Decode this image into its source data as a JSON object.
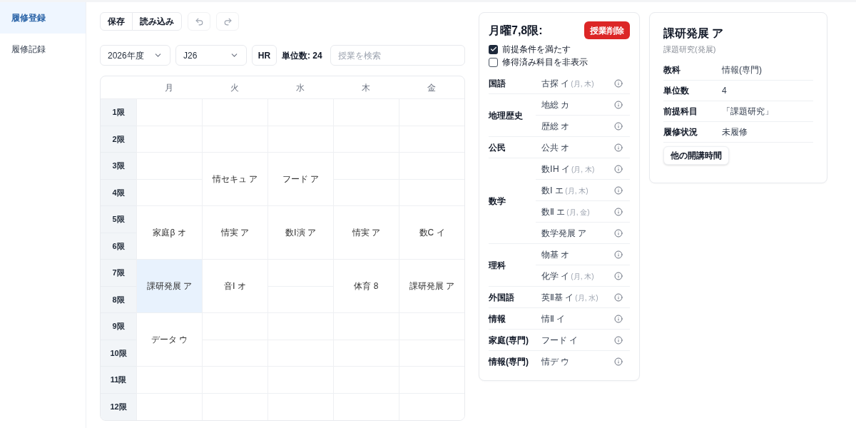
{
  "sidebar": {
    "items": [
      {
        "label": "履修登録",
        "selected": true
      },
      {
        "label": "履修記録",
        "selected": false
      }
    ]
  },
  "toolbar": {
    "file_buttons": [
      "保存",
      "読み込み"
    ]
  },
  "filters": {
    "year": "2026年度",
    "class": "J26",
    "hr_button": "HR",
    "credits": "単位数: 24",
    "search": {
      "placeholder": "授業を検索"
    }
  },
  "timetable": {
    "periods": [
      "1限",
      "2限",
      "3限",
      "4限",
      "5限",
      "6限",
      "7限",
      "8限",
      "9限",
      "10限",
      "11限",
      "12限"
    ],
    "days": [
      {
        "label": "月",
        "slots": [
          {
            "kind": "single",
            "selected": false
          },
          {
            "kind": "single",
            "selected": false
          },
          {
            "kind": "single",
            "selected": false
          },
          {
            "kind": "single",
            "selected": false
          },
          {
            "kind": "double",
            "label": "家庭β オ",
            "selected": false
          },
          {
            "kind": "double",
            "label": "課研発展 ア",
            "selected": true
          },
          {
            "kind": "double",
            "label": "データ ウ",
            "selected": false
          },
          {
            "kind": "single",
            "selected": false
          },
          {
            "kind": "single",
            "selected": false
          }
        ]
      },
      {
        "label": "火",
        "slots": [
          {
            "kind": "single",
            "selected": false
          },
          {
            "kind": "single",
            "selected": false
          },
          {
            "kind": "double",
            "label": "情セキュ ア",
            "selected": false
          },
          {
            "kind": "double",
            "label": "情実 ア",
            "selected": false
          },
          {
            "kind": "double",
            "label": "音Ⅰ オ",
            "selected": false
          },
          {
            "kind": "single",
            "selected": false
          },
          {
            "kind": "single",
            "selected": false
          },
          {
            "kind": "single",
            "selected": false
          },
          {
            "kind": "single",
            "selected": false
          }
        ]
      },
      {
        "label": "水",
        "slots": [
          {
            "kind": "single",
            "selected": false
          },
          {
            "kind": "single",
            "selected": false
          },
          {
            "kind": "double",
            "label": "フード ア",
            "selected": false
          },
          {
            "kind": "double",
            "label": "数Ⅰ演 ア",
            "selected": false
          },
          {
            "kind": "single",
            "selected": false
          },
          {
            "kind": "single",
            "selected": false
          },
          {
            "kind": "single",
            "selected": false
          },
          {
            "kind": "single",
            "selected": false
          },
          {
            "kind": "single",
            "selected": false
          },
          {
            "kind": "single",
            "selected": false
          }
        ]
      },
      {
        "label": "木",
        "slots": [
          {
            "kind": "single",
            "selected": false
          },
          {
            "kind": "single",
            "selected": false
          },
          {
            "kind": "single",
            "selected": false
          },
          {
            "kind": "single",
            "selected": false
          },
          {
            "kind": "double",
            "label": "情実 ア",
            "selected": false
          },
          {
            "kind": "double",
            "label": "体育 8",
            "selected": false
          },
          {
            "kind": "single",
            "selected": false
          },
          {
            "kind": "single",
            "selected": false
          },
          {
            "kind": "single",
            "selected": false
          },
          {
            "kind": "single",
            "selected": false
          }
        ]
      },
      {
        "label": "金",
        "slots": [
          {
            "kind": "single",
            "selected": false
          },
          {
            "kind": "single",
            "selected": false
          },
          {
            "kind": "single",
            "selected": false
          },
          {
            "kind": "single",
            "selected": false
          },
          {
            "kind": "double",
            "label": "数C イ",
            "selected": false
          },
          {
            "kind": "double",
            "label": "課研発展 ア",
            "selected": false
          },
          {
            "kind": "single",
            "selected": false
          },
          {
            "kind": "single",
            "selected": false
          },
          {
            "kind": "single",
            "selected": false
          },
          {
            "kind": "single",
            "selected": false
          }
        ]
      }
    ]
  },
  "slot_panel": {
    "title": "月曜7,8限:",
    "delete_button": "授業削除",
    "options": [
      {
        "label": "前提条件を満たす",
        "checked": true
      },
      {
        "label": "修得済み科目を非表示",
        "checked": false
      }
    ],
    "groups": [
      {
        "subject": "国語",
        "courses": [
          {
            "name": "古探 イ",
            "note": "(月, 木)"
          }
        ]
      },
      {
        "subject": "地理歴史",
        "courses": [
          {
            "name": "地総 カ"
          },
          {
            "name": "歴総 オ"
          }
        ]
      },
      {
        "subject": "公民",
        "courses": [
          {
            "name": "公共 オ"
          }
        ]
      },
      {
        "subject": "数学",
        "courses": [
          {
            "name": "数ⅠH イ",
            "note": "(月, 木)"
          },
          {
            "name": "数Ⅰ エ",
            "note": "(月, 木)"
          },
          {
            "name": "数Ⅱ エ",
            "note": "(月, 金)"
          },
          {
            "name": "数学発展 ア"
          }
        ]
      },
      {
        "subject": "理科",
        "courses": [
          {
            "name": "物基 オ"
          },
          {
            "name": "化学 イ",
            "note": "(月, 木)"
          }
        ]
      },
      {
        "subject": "外国語",
        "courses": [
          {
            "name": "英Ⅱ基 イ",
            "note": "(月, 水)"
          }
        ]
      },
      {
        "subject": "情報",
        "courses": [
          {
            "name": "情Ⅱ イ"
          }
        ]
      },
      {
        "subject": "家庭(専門)",
        "courses": [
          {
            "name": "フード イ"
          }
        ]
      },
      {
        "subject": "情報(専門)",
        "courses": [
          {
            "name": "情デ ウ"
          }
        ]
      }
    ]
  },
  "course_detail": {
    "title": "課研発展 ア",
    "subtitle": "課題研究(発展)",
    "fields": [
      {
        "label": "教科",
        "value": "情報(専門)"
      },
      {
        "label": "単位数",
        "value": "4"
      },
      {
        "label": "前提科目",
        "value": "「課題研究」"
      },
      {
        "label": "履修状況",
        "value": "未履修"
      }
    ],
    "button": "他の開講時間"
  }
}
